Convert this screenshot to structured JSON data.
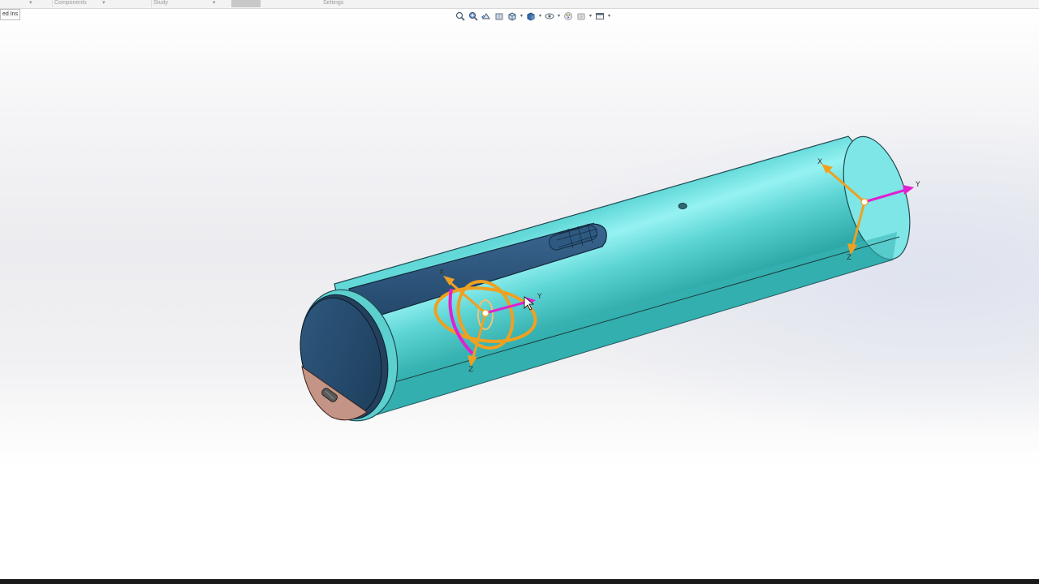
{
  "top_strip": {
    "tabs": [
      "▾",
      "Components",
      "▾",
      "Study",
      "▾",
      "",
      "",
      "Settings"
    ]
  },
  "addins_tab": "ed Ins",
  "hud_toolbar": {
    "buttons": [
      "zoom-to-fit-icon",
      "zoom-to-area-icon",
      "previous-view-icon",
      "section-view-icon",
      "view-orientation-icon",
      "display-style-icon",
      "hide-show-items-icon",
      "edit-appearance-icon",
      "apply-scene-icon",
      "view-settings-icon"
    ]
  },
  "triads": {
    "left": {
      "x": "X",
      "y": "Y",
      "z": "Z"
    },
    "right": {
      "x": "X",
      "y": "Y",
      "z": "Z"
    }
  },
  "colors": {
    "body": "#4fd0d0",
    "body_highlight": "#8ef0f0",
    "cap": "#2a4f72",
    "copper": "#c09080",
    "triad_orange": "#f0a020",
    "triad_magenta": "#e020d0"
  }
}
